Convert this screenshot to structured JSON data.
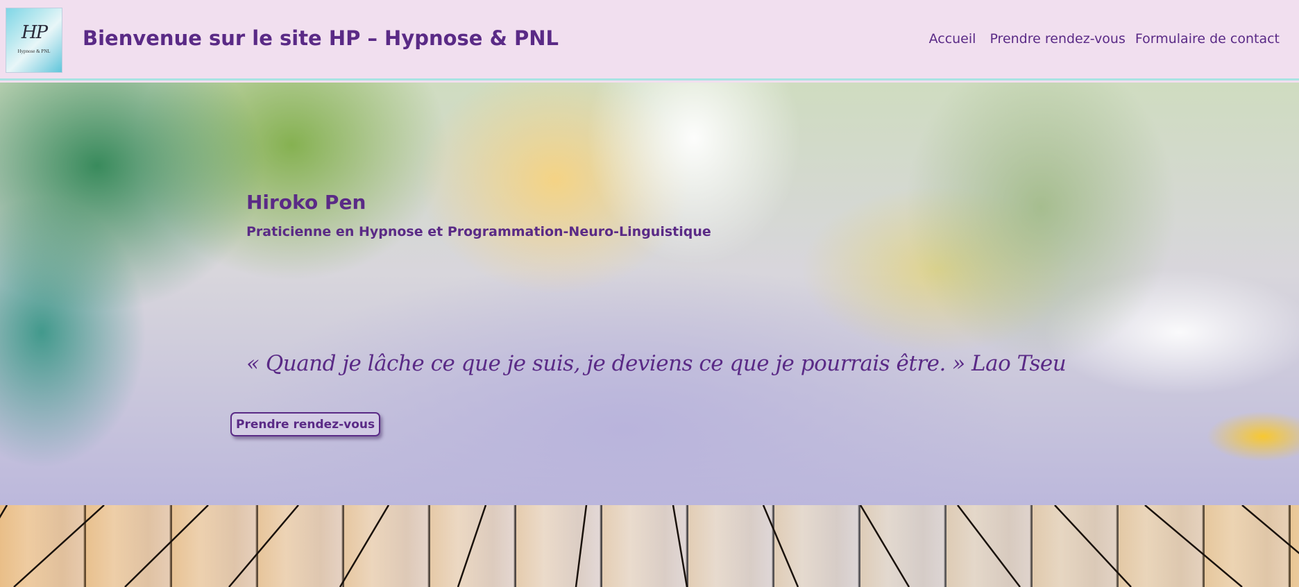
{
  "header": {
    "logo_alt": "HP Hypnose & PNL",
    "logo_mark": "HP",
    "logo_caption": "Hypnose & PNL",
    "site_title": "Bienvenue sur le site HP – Hypnose & PNL",
    "nav": [
      {
        "label": "Accueil"
      },
      {
        "label": "Prendre rendez-vous"
      },
      {
        "label": "Formulaire de contact"
      }
    ]
  },
  "hero": {
    "name": "Hiroko Pen",
    "subtitle": "Praticienne en Hypnose et Programmation-Neuro-Linguistique",
    "quote": "« Quand je lâche ce que je suis, je deviens ce que je pourrais être. » Lao Tseu",
    "button_label": "Prendre rendez-vous"
  },
  "colors": {
    "header_bg": "#f1dfef",
    "header_border": "#a9e3e3",
    "brand_purple": "#5a2a86"
  }
}
